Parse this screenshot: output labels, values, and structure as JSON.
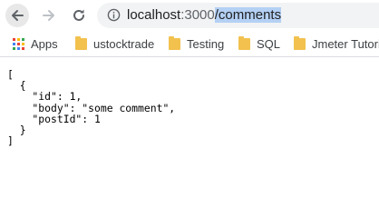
{
  "nav": {
    "back_icon": "arrow-left-icon",
    "forward_icon": "arrow-right-icon",
    "reload_icon": "reload-icon"
  },
  "address_bar": {
    "info_icon": "info-icon",
    "host": "localhost",
    "port": ":3000",
    "path": "/comments",
    "selection_color": "#b4d0f4"
  },
  "bookmarks": [
    {
      "label": "Apps",
      "icon": "apps-grid-icon"
    },
    {
      "label": "ustocktrade",
      "icon": "folder-icon"
    },
    {
      "label": "Testing",
      "icon": "folder-icon"
    },
    {
      "label": "SQL",
      "icon": "folder-icon"
    },
    {
      "label": "Jmeter Tutori",
      "icon": "folder-icon"
    }
  ],
  "page": {
    "json_text": "[\n  {\n    \"id\": 1,\n    \"body\": \"some comment\",\n    \"postId\": 1\n  }\n]"
  },
  "colors": {
    "folder": "#f2c14e",
    "omnibox_bg": "#f1f3f4",
    "back_button_bg": "#e8e8e8",
    "apps_grid": [
      "#ea4335",
      "#fbbc05",
      "#34a853",
      "#4285f4",
      "#ea4335",
      "#fbbc05",
      "#34a853",
      "#4285f4",
      "#ea4335"
    ]
  }
}
